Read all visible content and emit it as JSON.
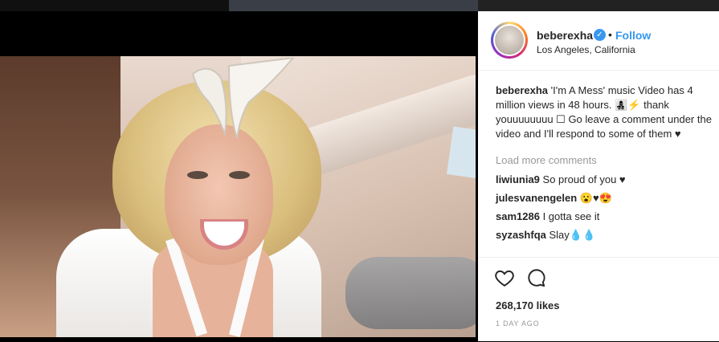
{
  "post": {
    "username": "beberexha",
    "verified_icon": "verified-badge-icon",
    "separator": "•",
    "follow_label": "Follow",
    "location": "Los Angeles, California"
  },
  "caption": {
    "username": "beberexha",
    "text": "'I'm A Mess' music Video has 4 million views in 48 hours. 👩‍👧‍👦⚡ thank youuuuuuuu ☐ Go leave a comment under the video and I'll respond to some of them ♥"
  },
  "load_more_label": "Load more comments",
  "comments": [
    {
      "user": "liwiunia9",
      "text": "So proud of you ♥"
    },
    {
      "user": "julesvanengelen",
      "text": "😮♥😍"
    },
    {
      "user": "sam1286",
      "text": "I gotta see it"
    },
    {
      "user": "syzashfqa",
      "text": "Slay💧💧"
    }
  ],
  "stats": {
    "likes": "268,170 likes",
    "time": "1 DAY AGO"
  },
  "colors": {
    "accent": "#3897f0",
    "text": "#262626",
    "muted": "#999999"
  }
}
